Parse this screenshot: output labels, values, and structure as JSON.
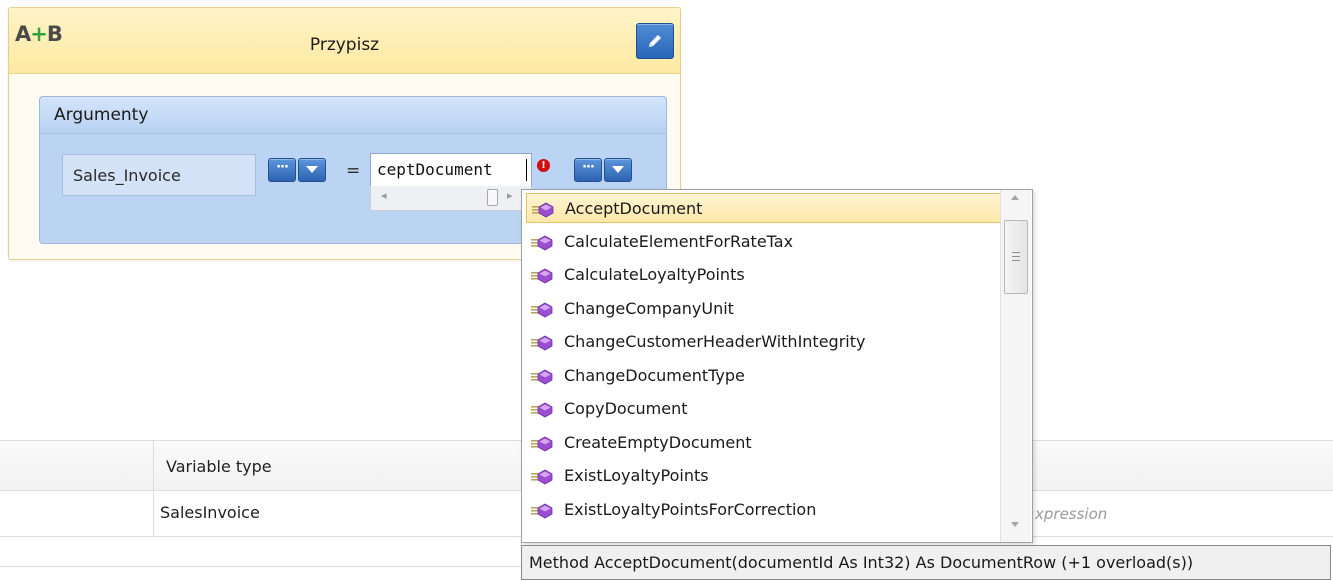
{
  "activity": {
    "icon_a": "A",
    "icon_plus": "+",
    "icon_b": "B",
    "title": "Przypisz",
    "edit_icon": "pencil-icon"
  },
  "arguments": {
    "title": "Argumenty",
    "variable_name": "Sales_Invoice",
    "browse_button_label": "···",
    "equals": "=",
    "expression_value": "ceptDocument",
    "error_glyph": "!"
  },
  "variables_grid": {
    "column_variable_type": "Variable type",
    "rows": [
      {
        "variable_type": "SalesInvoice",
        "expression_placeholder": "xpression"
      }
    ]
  },
  "intellisense": {
    "items": [
      "AcceptDocument",
      "CalculateElementForRateTax",
      "CalculateLoyaltyPoints",
      "ChangeCompanyUnit",
      "ChangeCustomerHeaderWithIntegrity",
      "ChangeDocumentType",
      "CopyDocument",
      "CreateEmptyDocument",
      "ExistLoyaltyPoints",
      "ExistLoyaltyPointsForCorrection"
    ],
    "selected_index": 0,
    "tooltip": "Method AcceptDocument(documentId As Int32) As DocumentRow (+1 overload(s))"
  },
  "colors": {
    "header_yellow": "#fde9a2",
    "arguments_blue": "#bcd4f3",
    "button_blue": "#2d63b1",
    "selection_yellow": "#fde7a9",
    "error_red": "#d10f0f"
  }
}
